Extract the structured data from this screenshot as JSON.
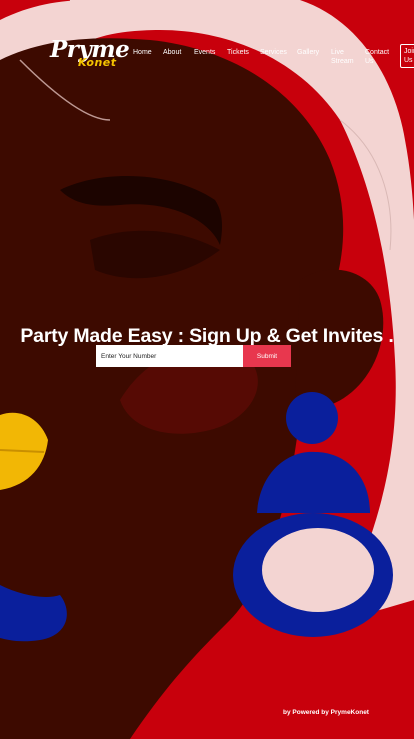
{
  "brand": {
    "logo_main": "Pryme",
    "logo_sub": "Konet"
  },
  "nav": {
    "home": "Home",
    "about": "About",
    "events": "Events",
    "tickets": "Tickets",
    "services": "Services",
    "gallery": "Gallery",
    "live_stream": "Live Stream",
    "contact_us": "Contact Us",
    "join_us": "Join Us"
  },
  "signup": {
    "headline": "Party Made Easy : Sign Up & Get Invites .",
    "input_placeholder": "Enter Your Number",
    "input_value": "",
    "submit_label": "Submit"
  },
  "footer": {
    "credit": "by Powered by PrymeKonet"
  },
  "colors": {
    "background_red": "#c8000c",
    "skin": "#3d0a00",
    "hair": "#f3d4d2",
    "earring_blue": "#0a1f9c",
    "lips": "#f2b705",
    "submit": "#e8374e"
  }
}
